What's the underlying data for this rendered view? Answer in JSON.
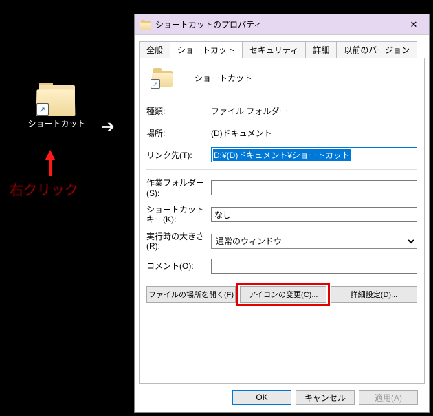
{
  "desktop": {
    "shortcut_label": "ショートカット"
  },
  "annotation": {
    "right_click_label": "右クリック"
  },
  "dialog": {
    "title": "ショートカットのプロパティ",
    "tabs": {
      "general": "全般",
      "shortcut": "ショートカット",
      "security": "セキュリティ",
      "details": "詳細",
      "previous_versions": "以前のバージョン"
    },
    "header_name": "ショートカット",
    "fields": {
      "type_label": "種類:",
      "type_value": "ファイル フォルダー",
      "location_label": "場所:",
      "location_value": "(D)ドキュメント",
      "target_label": "リンク先(T):",
      "target_value": "D:¥(D)ドキュメント¥ショートカット",
      "workdir_label": "作業フォルダー(S):",
      "workdir_value": "",
      "shortcut_key_label": "ショートカット キー(K):",
      "shortcut_key_value": "なし",
      "run_label": "実行時の大きさ(R):",
      "run_value": "通常のウィンドウ",
      "comment_label": "コメント(O):",
      "comment_value": ""
    },
    "buttons": {
      "open_location": "ファイルの場所を開く(F)",
      "change_icon": "アイコンの変更(C)...",
      "advanced": "詳細設定(D)...",
      "ok": "OK",
      "cancel": "キャンセル",
      "apply": "適用(A)"
    }
  }
}
